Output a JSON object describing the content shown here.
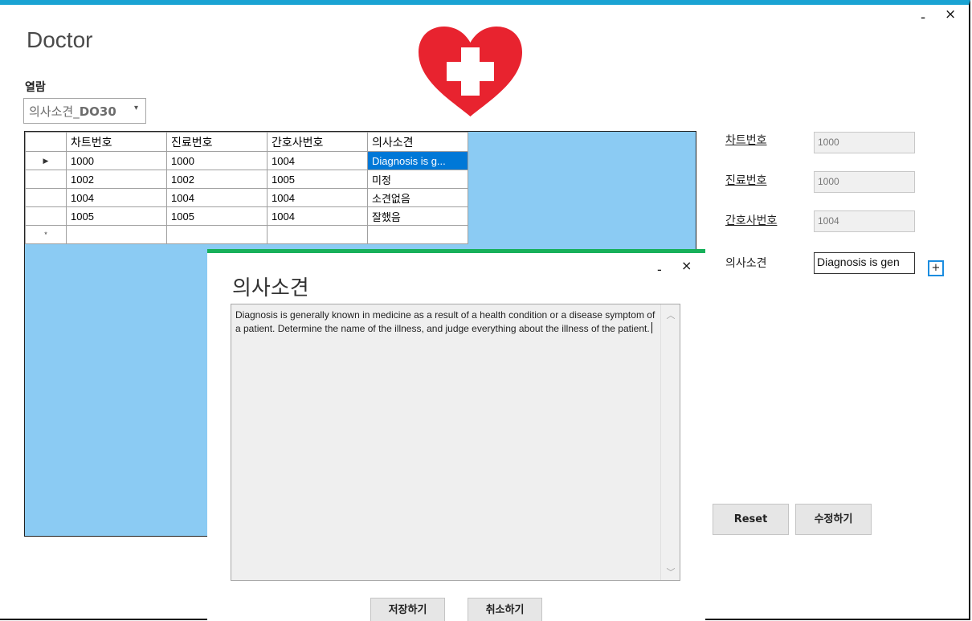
{
  "window": {
    "title": "Doctor",
    "minimize": "-",
    "close": "×"
  },
  "view": {
    "label": "열람",
    "combo_prefix": "의사소견_",
    "combo_bold": "DO30",
    "combo_arrow": "▾"
  },
  "grid": {
    "columns": [
      "차트번호",
      "진료번호",
      "간호사번호",
      "의사소견"
    ],
    "rows": [
      {
        "indicator": "▶",
        "cells": [
          "1000",
          "1000",
          "1004",
          "Diagnosis is g..."
        ]
      },
      {
        "indicator": "",
        "cells": [
          "1002",
          "1002",
          "1005",
          "미정"
        ]
      },
      {
        "indicator": "",
        "cells": [
          "1004",
          "1004",
          "1004",
          "소견없음"
        ]
      },
      {
        "indicator": "",
        "cells": [
          "1005",
          "1005",
          "1004",
          "잘했음"
        ]
      }
    ],
    "new_row_indicator": "*"
  },
  "details": {
    "chart_label": "차트번호",
    "chart_value": "1000",
    "treatment_label": "진료번호",
    "treatment_value": "1000",
    "nurse_label": "간호사번호",
    "nurse_value": "1004",
    "opinion_label": "의사소견",
    "opinion_value": "Diagnosis is gen",
    "plus": "+"
  },
  "buttons": {
    "reset": "Reset",
    "edit": "수정하기"
  },
  "dialog": {
    "title": "의사소견",
    "minimize": "-",
    "close": "×",
    "text": "Diagnosis is generally known in medicine as a result of a health condition or a disease symptom of a patient. Determine the name of the illness, and judge everything about the illness of the patient.",
    "save": "저장하기",
    "cancel": "취소하기"
  },
  "colors": {
    "accent": "#1aa3d3",
    "dialog_accent": "#17b05a",
    "grid_bg": "#8bcbf3",
    "selection": "#0078d7",
    "heart": "#e8232f"
  }
}
